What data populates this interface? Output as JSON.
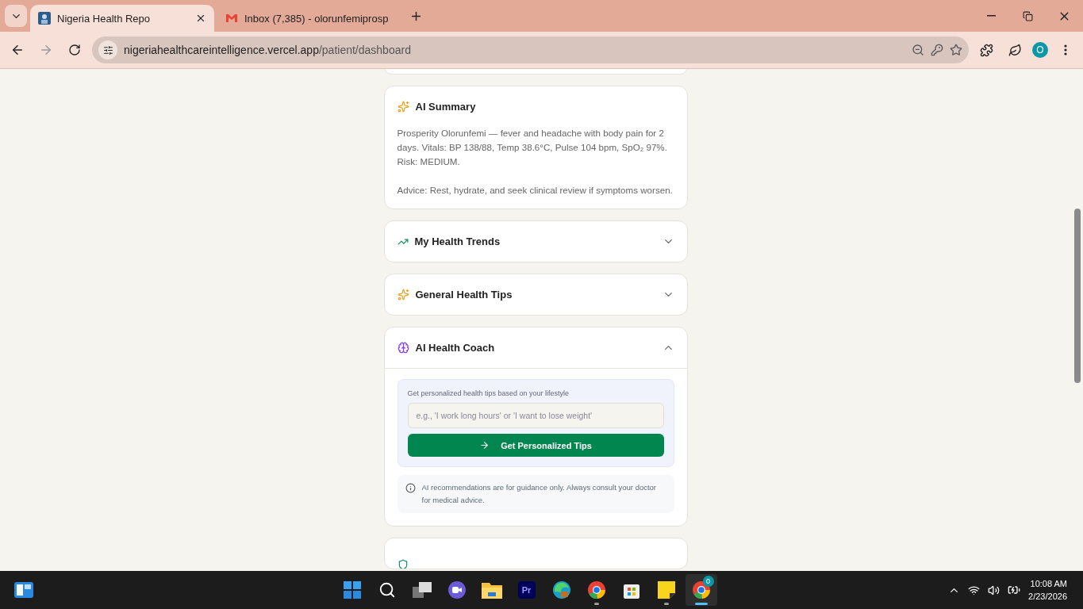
{
  "browser": {
    "tabs": [
      {
        "title": "Nigeria Health Repo",
        "selected": true
      },
      {
        "title": "Inbox (7,385) - olorunfemiprosp",
        "selected": false
      }
    ],
    "address": {
      "domain": "nigeriahealthcareintelligence.vercel.app",
      "path": "/patient/dashboard"
    },
    "profile_initial": "O"
  },
  "summary": {
    "title": "AI Summary",
    "paragraphs": [
      "Prosperity Olorunfemi — fever and headache with body pain for 2 days. Vitals: BP 138/88, Temp 38.6°C, Pulse 104 bpm, SpO₂ 97%. Risk: MEDIUM.",
      "Advice: Rest, hydrate, and seek clinical review if symptoms worsen."
    ]
  },
  "sections": [
    {
      "title": "My Health Trends",
      "expanded": false
    },
    {
      "title": "General Health Tips",
      "expanded": false
    },
    {
      "title": "AI Health Coach",
      "expanded": true
    }
  ],
  "coach": {
    "prompt": "Get personalized health tips based on your lifestyle",
    "placeholder": "e.g., 'I work long hours' or 'I want to lose weight'",
    "button": "Get Personalized Tips",
    "disclaimer": "AI recommendations are for guidance only. Always consult your doctor for medical advice."
  },
  "taskbar": {
    "apps": [
      {
        "kind": "start",
        "running": false,
        "selected": false
      },
      {
        "kind": "search",
        "running": false,
        "selected": false
      },
      {
        "kind": "taskview",
        "running": false,
        "selected": false
      },
      {
        "kind": "meet",
        "running": false,
        "selected": false
      },
      {
        "kind": "folder",
        "running": false,
        "selected": false
      },
      {
        "kind": "premiere",
        "label": "Pr",
        "running": false,
        "selected": false
      },
      {
        "kind": "edge",
        "running": false,
        "selected": false
      },
      {
        "kind": "chrome",
        "running": true,
        "selected": false
      },
      {
        "kind": "store",
        "running": false,
        "selected": false
      },
      {
        "kind": "notes",
        "running": true,
        "selected": false
      },
      {
        "kind": "chrome",
        "badge": "0",
        "running": true,
        "selected": true
      }
    ],
    "time": "10:08 AM",
    "date": "2/23/2026"
  }
}
